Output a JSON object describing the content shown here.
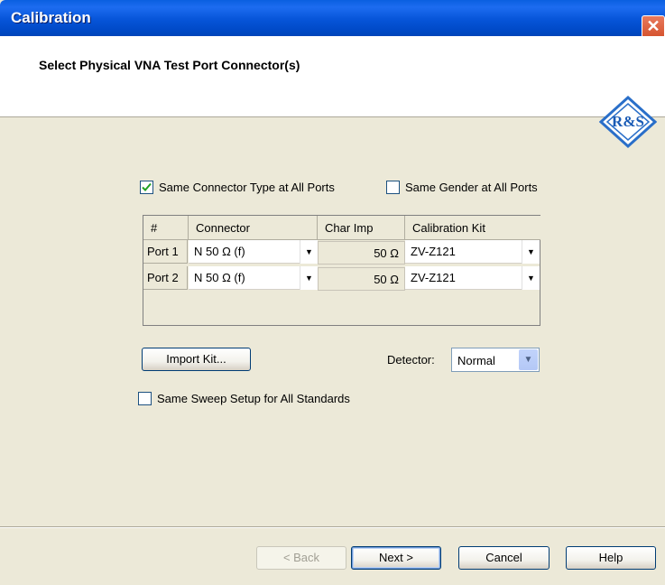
{
  "window": {
    "title": "Calibration",
    "close_glyph": "✕"
  },
  "header": {
    "heading": "Select Physical VNA Test Port Connector(s)",
    "logo_letters": "R&S"
  },
  "options": {
    "same_connector": {
      "label": "Same Connector Type at All Ports",
      "checked": true
    },
    "same_gender": {
      "label": "Same Gender at All Ports",
      "checked": false
    },
    "same_sweep": {
      "label": "Same Sweep Setup for All Standards",
      "checked": false
    }
  },
  "table": {
    "columns": [
      "#",
      "Connector",
      "Char Imp",
      "Calibration Kit"
    ],
    "rows": [
      {
        "port": "Port 1",
        "connector": "N 50 Ω (f)",
        "char_imp": "50 Ω",
        "kit": "ZV-Z121"
      },
      {
        "port": "Port 2",
        "connector": "N 50 Ω (f)",
        "char_imp": "50 Ω",
        "kit": "ZV-Z121"
      }
    ]
  },
  "import_kit_label": "Import Kit...",
  "detector": {
    "label": "Detector:",
    "value": "Normal"
  },
  "footer": {
    "back": "< Back",
    "next": "Next >",
    "cancel": "Cancel",
    "help": "Help"
  }
}
